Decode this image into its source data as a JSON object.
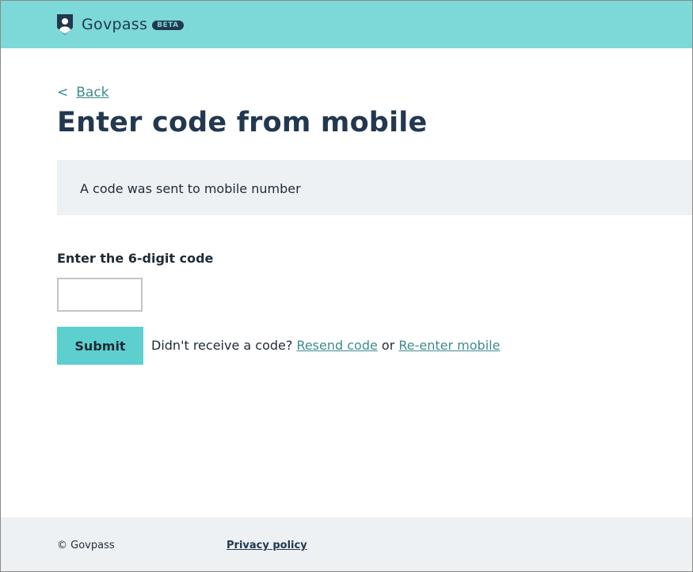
{
  "header": {
    "brand": "Govpass",
    "badge": "BETA",
    "logo_icon": "shield-person-icon",
    "bg_color": "#7dd8d8"
  },
  "nav": {
    "back_chevron": "<",
    "back_label": "Back"
  },
  "page": {
    "title": "Enter code from mobile"
  },
  "notice": {
    "text": "A code was sent to mobile number"
  },
  "form": {
    "code_label": "Enter the 6-digit code",
    "code_value": "",
    "submit_label": "Submit",
    "resend_prefix": "Didn't receive a code?",
    "resend_link": "Resend code",
    "or_text": "or",
    "reenter_link": "Re-enter mobile",
    "accent_color": "#5dcfcf"
  },
  "footer": {
    "copyright": "© Govpass",
    "privacy_link": "Privacy policy"
  }
}
